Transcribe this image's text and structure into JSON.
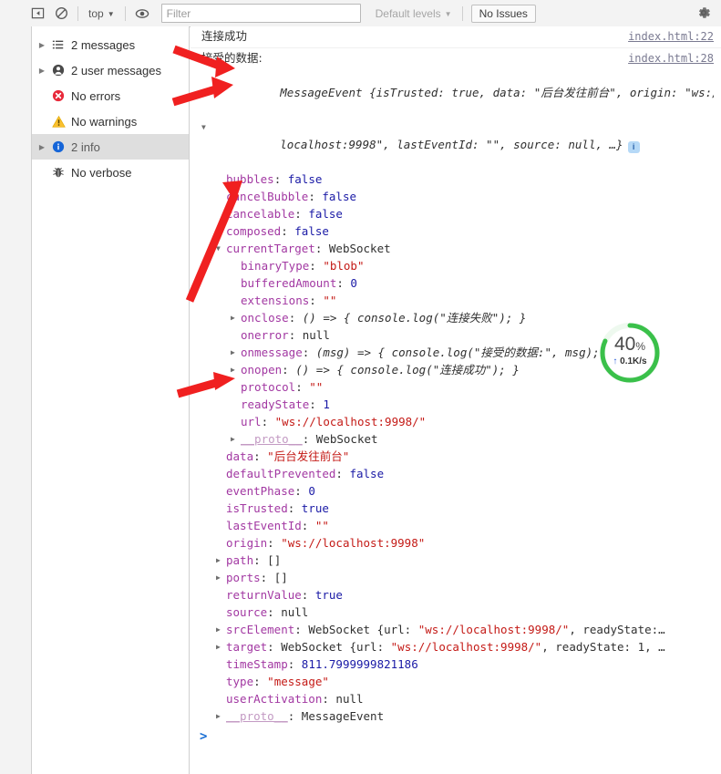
{
  "toolbar": {
    "sidebar_toggle_icon": "panel-toggle-icon",
    "clear_console_icon": "clear-console-icon",
    "context_selector": {
      "label": "top",
      "caret": "▼"
    },
    "live_expression_icon": "eye-icon",
    "filter": {
      "value": "",
      "placeholder": "Filter"
    },
    "levels_selector": {
      "label": "Default levels",
      "caret": "▼"
    },
    "issues_button": "No Issues",
    "settings_icon": "gear-icon"
  },
  "sidebar": {
    "items": [
      {
        "label": "2 messages",
        "icon": "list-icon",
        "arrow": "▶",
        "expandable": true,
        "selected": false
      },
      {
        "label": "2 user messages",
        "icon": "person-icon",
        "arrow": "▶",
        "expandable": true,
        "selected": false
      },
      {
        "label": "No errors",
        "icon": "error-icon",
        "arrow": "",
        "expandable": false,
        "selected": false
      },
      {
        "label": "No warnings",
        "icon": "warning-icon",
        "arrow": "",
        "expandable": false,
        "selected": false
      },
      {
        "label": "2 info",
        "icon": "info-icon",
        "arrow": "▶",
        "expandable": true,
        "selected": true
      },
      {
        "label": "No verbose",
        "icon": "bug-icon",
        "arrow": "",
        "expandable": false,
        "selected": false
      }
    ]
  },
  "console": {
    "messages": [
      {
        "text": "连接成功",
        "source": "index.html:22"
      },
      {
        "text": "接受的数据:",
        "source": "index.html:28"
      }
    ],
    "object_header": {
      "line1_type": "MessageEvent ",
      "line1_parts": [
        {
          "t": "{isTrusted: ",
          "c": "punc"
        },
        {
          "t": "true",
          "c": "vbool"
        },
        {
          "t": ", data: ",
          "c": "punc"
        },
        {
          "t": "\"后台发往前台\"",
          "c": "vstr"
        },
        {
          "t": ", origin: ",
          "c": "punc"
        },
        {
          "t": "\"ws://",
          "c": "vstr"
        }
      ],
      "line2_parts": [
        {
          "t": "localhost:9998\"",
          "c": "vstr"
        },
        {
          "t": ", lastEventId: ",
          "c": "punc"
        },
        {
          "t": "\"\"",
          "c": "vstr"
        },
        {
          "t": ", source: ",
          "c": "punc"
        },
        {
          "t": "null",
          "c": "vnull"
        },
        {
          "t": ", …}",
          "c": "punc"
        }
      ],
      "info_badge": "i",
      "expander": "▼"
    },
    "properties": [
      {
        "indent": 1,
        "tri": "",
        "key": "bubbles",
        "sep": ": ",
        "value": "false",
        "vclass": "vbool"
      },
      {
        "indent": 1,
        "tri": "",
        "key": "cancelBubble",
        "sep": ": ",
        "value": "false",
        "vclass": "vbool"
      },
      {
        "indent": 1,
        "tri": "",
        "key": "cancelable",
        "sep": ": ",
        "value": "false",
        "vclass": "vbool"
      },
      {
        "indent": 1,
        "tri": "",
        "key": "composed",
        "sep": ": ",
        "value": "false",
        "vclass": "vbool"
      },
      {
        "indent": 1,
        "tri": "▼",
        "key": "currentTarget",
        "sep": ": ",
        "value": "WebSocket",
        "vclass": "vobj"
      },
      {
        "indent": 2,
        "tri": "",
        "key": "binaryType",
        "sep": ": ",
        "value": "\"blob\"",
        "vclass": "vstr"
      },
      {
        "indent": 2,
        "tri": "",
        "key": "bufferedAmount",
        "sep": ": ",
        "value": "0",
        "vclass": "vnum"
      },
      {
        "indent": 2,
        "tri": "",
        "key": "extensions",
        "sep": ": ",
        "value": "\"\"",
        "vclass": "vstr"
      },
      {
        "indent": 2,
        "tri": "▶",
        "key": "onclose",
        "sep": ": ",
        "value": "() => { console.log(\"连接失败\"); }",
        "vclass": "vfn"
      },
      {
        "indent": 2,
        "tri": "",
        "key": "onerror",
        "sep": ": ",
        "value": "null",
        "vclass": "vnull"
      },
      {
        "indent": 2,
        "tri": "▶",
        "key": "onmessage",
        "sep": ": ",
        "value": "(msg) => { console.log(\"接受的数据:\", msg); }",
        "vclass": "vfn"
      },
      {
        "indent": 2,
        "tri": "▶",
        "key": "onopen",
        "sep": ": ",
        "value": "() => { console.log(\"连接成功\"); }",
        "vclass": "vfn"
      },
      {
        "indent": 2,
        "tri": "",
        "key": "protocol",
        "sep": ": ",
        "value": "\"\"",
        "vclass": "vstr"
      },
      {
        "indent": 2,
        "tri": "",
        "key": "readyState",
        "sep": ": ",
        "value": "1",
        "vclass": "vnum"
      },
      {
        "indent": 2,
        "tri": "",
        "key": "url",
        "sep": ": ",
        "value": "\"ws://localhost:9998/\"",
        "vclass": "vstr"
      },
      {
        "indent": 2,
        "tri": "▶",
        "key": "__proto__",
        "sep": ": ",
        "value": "WebSocket",
        "vclass": "vobj",
        "proto": true
      },
      {
        "indent": 1,
        "tri": "",
        "key": "data",
        "sep": ": ",
        "value": "\"后台发往前台\"",
        "vclass": "vstr"
      },
      {
        "indent": 1,
        "tri": "",
        "key": "defaultPrevented",
        "sep": ": ",
        "value": "false",
        "vclass": "vbool"
      },
      {
        "indent": 1,
        "tri": "",
        "key": "eventPhase",
        "sep": ": ",
        "value": "0",
        "vclass": "vnum"
      },
      {
        "indent": 1,
        "tri": "",
        "key": "isTrusted",
        "sep": ": ",
        "value": "true",
        "vclass": "vbool"
      },
      {
        "indent": 1,
        "tri": "",
        "key": "lastEventId",
        "sep": ": ",
        "value": "\"\"",
        "vclass": "vstr"
      },
      {
        "indent": 1,
        "tri": "",
        "key": "origin",
        "sep": ": ",
        "value": "\"ws://localhost:9998\"",
        "vclass": "vstr"
      },
      {
        "indent": 1,
        "tri": "▶",
        "key": "path",
        "sep": ": ",
        "value": "[]",
        "vclass": "vobj"
      },
      {
        "indent": 1,
        "tri": "▶",
        "key": "ports",
        "sep": ": ",
        "value": "[]",
        "vclass": "vobj"
      },
      {
        "indent": 1,
        "tri": "",
        "key": "returnValue",
        "sep": ": ",
        "value": "true",
        "vclass": "vbool"
      },
      {
        "indent": 1,
        "tri": "",
        "key": "source",
        "sep": ": ",
        "value": "null",
        "vclass": "vnull"
      },
      {
        "indent": 1,
        "tri": "▶",
        "key": "srcElement",
        "sep": ": ",
        "value": "WebSocket {url: \"ws://localhost:9998/\", readyState:…",
        "vclass": "vobj",
        "mixed": "srcElement"
      },
      {
        "indent": 1,
        "tri": "▶",
        "key": "target",
        "sep": ": ",
        "value": "WebSocket {url: \"ws://localhost:9998/\", readyState: 1, …",
        "vclass": "vobj",
        "mixed": "target"
      },
      {
        "indent": 1,
        "tri": "",
        "key": "timeStamp",
        "sep": ": ",
        "value": "811.7999999821186",
        "vclass": "vnum"
      },
      {
        "indent": 1,
        "tri": "",
        "key": "type",
        "sep": ": ",
        "value": "\"message\"",
        "vclass": "vstr"
      },
      {
        "indent": 1,
        "tri": "",
        "key": "userActivation",
        "sep": ": ",
        "value": "null",
        "vclass": "vnull"
      },
      {
        "indent": 1,
        "tri": "▶",
        "key": "__proto__",
        "sep": ": ",
        "value": "MessageEvent",
        "vclass": "vobj",
        "proto": true
      }
    ],
    "prompt_caret": ">"
  },
  "speed_widget": {
    "percent": "40",
    "percent_suffix": "%",
    "rate_arrow": "↑",
    "rate": "0.1K/s",
    "ring_color": "#3ac04a",
    "ring_track_color": "#e8f7ea",
    "progress": 0.82
  },
  "annotations": {
    "arrow_color": "#f02020",
    "arrows": [
      {
        "name": "arrow-to-received-data"
      },
      {
        "name": "arrow-to-messageevent-expander"
      },
      {
        "name": "arrow-to-currenttarget"
      },
      {
        "name": "arrow-to-data-property"
      }
    ]
  },
  "colors": {
    "key": "#a238a2",
    "string": "#c41a16",
    "number": "#1a1aa6",
    "link": "#7a7a91",
    "selection": "#dedede",
    "toolbar_bg": "#f3f3f3"
  }
}
